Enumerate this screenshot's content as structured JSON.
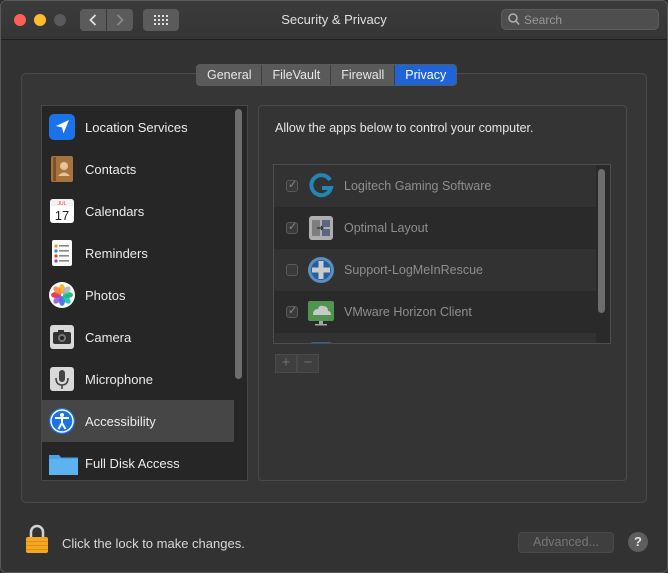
{
  "window": {
    "title": "Security & Privacy"
  },
  "search": {
    "placeholder": "Search"
  },
  "tabs": [
    {
      "label": "General"
    },
    {
      "label": "FileVault"
    },
    {
      "label": "Firewall"
    },
    {
      "label": "Privacy",
      "active": true
    }
  ],
  "sidebar": {
    "items": [
      {
        "label": "Location Services",
        "icon": "location-arrow-icon"
      },
      {
        "label": "Contacts",
        "icon": "contacts-book-icon"
      },
      {
        "label": "Calendars",
        "icon": "calendar-icon",
        "icon_text_month": "JUL",
        "icon_text_day": "17"
      },
      {
        "label": "Reminders",
        "icon": "reminders-list-icon"
      },
      {
        "label": "Photos",
        "icon": "photos-flower-icon"
      },
      {
        "label": "Camera",
        "icon": "camera-icon"
      },
      {
        "label": "Microphone",
        "icon": "microphone-icon"
      },
      {
        "label": "Accessibility",
        "icon": "accessibility-icon",
        "selected": true
      },
      {
        "label": "Full Disk Access",
        "icon": "folder-icon"
      }
    ]
  },
  "main": {
    "instruction": "Allow the apps below to control your computer.",
    "apps": [
      {
        "label": "Logitech Gaming Software",
        "checked": true,
        "icon": "logitech-g-icon"
      },
      {
        "label": "Optimal Layout",
        "checked": true,
        "icon": "optimal-layout-icon"
      },
      {
        "label": "Support-LogMeInRescue",
        "checked": false,
        "icon": "logmein-rescue-icon"
      },
      {
        "label": "VMware Horizon Client",
        "checked": true,
        "icon": "vmware-horizon-icon"
      }
    ],
    "add_label": "+",
    "remove_label": "−"
  },
  "footer": {
    "lock_text": "Click the lock to make changes.",
    "advanced_label": "Advanced...",
    "help_label": "?"
  },
  "colors": {
    "accent": "#1e63d8",
    "close": "#fe5f57",
    "minimize": "#febb2e"
  }
}
